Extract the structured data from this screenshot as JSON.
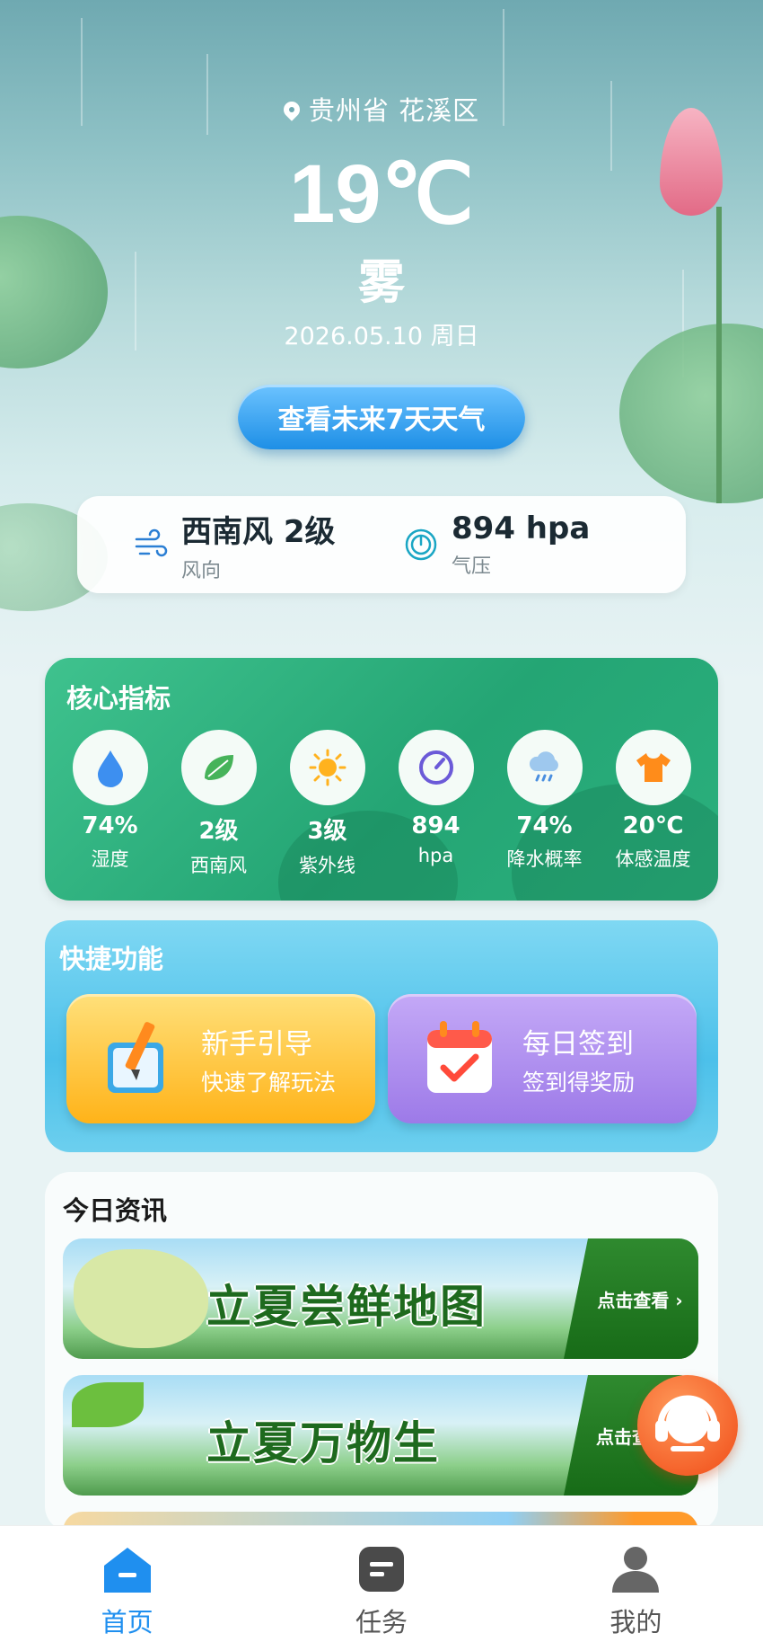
{
  "location": "贵州省 花溪区",
  "temperature": "19℃",
  "condition": "雾",
  "date": "2026.05.10 周日",
  "forecast_button": "查看未来7天天气",
  "stats": [
    {
      "value": "西南风 2级",
      "label": "风向",
      "icon": "wind-icon"
    },
    {
      "value": "894 hpa",
      "label": "气压",
      "icon": "pressure-gauge-icon"
    }
  ],
  "core": {
    "title": "核心指标",
    "metrics": [
      {
        "value": "74%",
        "label": "湿度",
        "icon": "water-drop-icon"
      },
      {
        "value": "2级",
        "label": "西南风",
        "icon": "leaf-wind-icon"
      },
      {
        "value": "3级",
        "label": "紫外线",
        "icon": "sun-icon"
      },
      {
        "value": "894",
        "label": "hpa",
        "icon": "gauge-icon"
      },
      {
        "value": "74%",
        "label": "降水概率",
        "icon": "rain-cloud-icon"
      },
      {
        "value": "20℃",
        "label": "体感温度",
        "icon": "tshirt-icon"
      }
    ]
  },
  "quick": {
    "title": "快捷功能",
    "cards": [
      {
        "title": "新手引导",
        "subtitle": "快速了解玩法",
        "icon": "pencil-book-icon"
      },
      {
        "title": "每日签到",
        "subtitle": "签到得奖励",
        "icon": "calendar-check-icon"
      }
    ]
  },
  "news": {
    "title": "今日资讯",
    "banners": [
      {
        "title": "立夏尝鲜地图",
        "cta": "点击查看 ›"
      },
      {
        "title": "立夏万物生",
        "cta": "点击查"
      }
    ]
  },
  "tabs": [
    {
      "label": "首页",
      "icon": "home-icon",
      "active": true
    },
    {
      "label": "任务",
      "icon": "task-icon",
      "active": false
    },
    {
      "label": "我的",
      "icon": "user-icon",
      "active": false
    }
  ],
  "colors": {
    "accent": "#1f8fef",
    "core_green": "#2bb07d",
    "quick_blue": "#4cc0ea"
  }
}
